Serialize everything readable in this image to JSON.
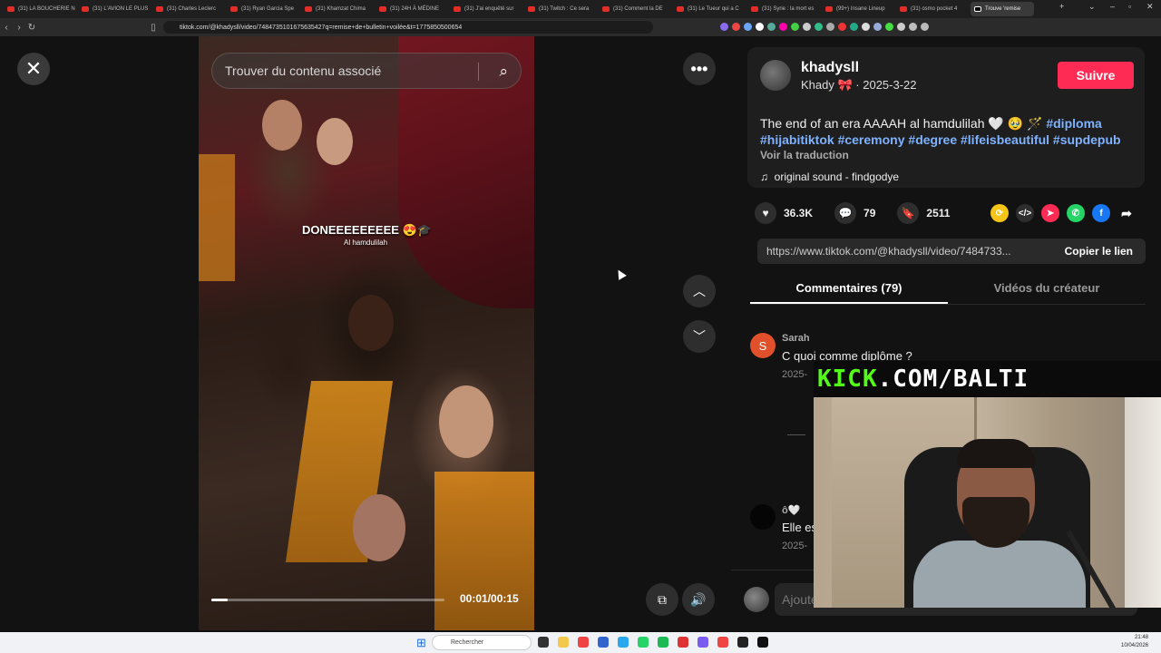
{
  "browser": {
    "tabs": [
      {
        "label": "(31) LA BOUCHERIE N",
        "active": false
      },
      {
        "label": "(31) L'AVION LE PLUS",
        "active": false
      },
      {
        "label": "(31) Charles Leclerc",
        "active": false
      },
      {
        "label": "(31) Ryan Garcia Spe",
        "active": false
      },
      {
        "label": "(31) Khamzat Chima",
        "active": false
      },
      {
        "label": "(31) 24H À MÉDINE",
        "active": false
      },
      {
        "label": "(31) J'ai enquêté sur",
        "active": false
      },
      {
        "label": "(31) Twitch : Ce sera",
        "active": false
      },
      {
        "label": "(31) Comment la DE",
        "active": false
      },
      {
        "label": "(31) Le Tueur qui a C",
        "active": false
      },
      {
        "label": "(31) Syrie : la mort es",
        "active": false
      },
      {
        "label": "(99+) Insane Lineup",
        "active": false
      },
      {
        "label": "(31) osmo pocket 4",
        "active": false
      },
      {
        "label": "Trouve 'remise",
        "active": true
      }
    ],
    "url": "tiktok.com/@khadysll/video/7484735101675635427q=remise+de+bulletin+voilée&t=1775850500654"
  },
  "video": {
    "search_placeholder": "Trouver du contenu associé",
    "overlay_text": "DONEEEEEEEEE 😍🎓",
    "overlay_subtext": "Al hamdulilah",
    "timecode": "00:01/00:15",
    "progress_fraction": 0.07
  },
  "post": {
    "username": "khadysll",
    "display_name": "Khady 🎀",
    "date": "· 2025-3-22",
    "follow_label": "Suivre",
    "description": "The end of an era AAAAH al hamdulilah 🤍 🥹 🪄",
    "hashtags": [
      "#diploma",
      "#hijabitiktok",
      "#ceremony",
      "#degree",
      "#lifeisbeautiful",
      "#supdepub"
    ],
    "translate_label": "Voir la traduction",
    "sound": "original sound - findgodye",
    "likes": "36.3K",
    "comments": "79",
    "saves": "2511",
    "link": "https://www.tiktok.com/@khadysll/video/7484733...",
    "copy_label": "Copier le lien"
  },
  "tabs": {
    "comments": "Commentaires (79)",
    "creator_videos": "Vidéos du créateur"
  },
  "comments": [
    {
      "initial": "S",
      "name": "Sarah",
      "text": "C quoi comme diplôme ?",
      "date": "2025-"
    },
    {
      "initial": "",
      "name": "ô🤍",
      "text": "Elle es",
      "date": "2025-"
    }
  ],
  "add_comment_placeholder": "Ajouter un commentaire...",
  "webcam": {
    "brand": "KICK",
    "handle": ".COM/BALTI"
  },
  "taskbar": {
    "search_placeholder": "Rechercher",
    "time": "21:48",
    "date": "10/04/2026"
  },
  "colors": {
    "accent": "#fe2c55",
    "hashtag": "#7fb3ff",
    "kick_green": "#53fc18"
  }
}
